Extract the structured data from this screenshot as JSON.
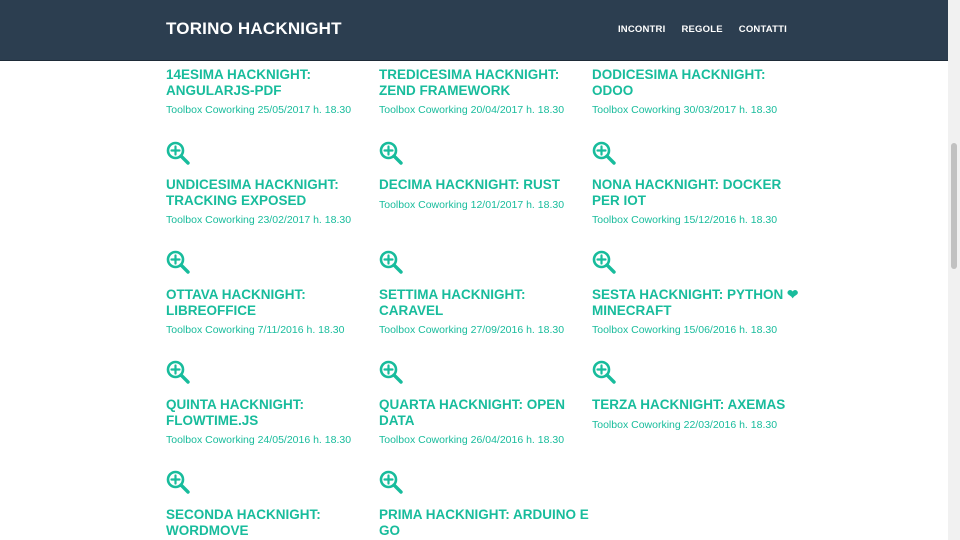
{
  "navbar": {
    "brand": "TORINO HACKNIGHT",
    "links": [
      "INCONTRI",
      "REGOLE",
      "CONTATTI"
    ]
  },
  "colors": {
    "navbar_bg": "#2c3e50",
    "accent": "#18bc9c"
  },
  "events": [
    {
      "title": "14ESIMA HACKNIGHT: ANGULARJS-PDF",
      "meta": "Toolbox Coworking 25/05/2017 h. 18.30",
      "icon": "zoom-in-icon"
    },
    {
      "title": "TREDICESIMA HACKNIGHT: ZEND FRAMEWORK",
      "meta": "Toolbox Coworking 20/04/2017 h. 18.30",
      "icon": "zoom-in-icon"
    },
    {
      "title": "DODICESIMA HACKNIGHT: ODOO",
      "meta": "Toolbox Coworking 30/03/2017 h. 18.30",
      "icon": "zoom-in-icon"
    },
    {
      "title": "UNDICESIMA HACKNIGHT: TRACKING EXPOSED",
      "meta": "Toolbox Coworking 23/02/2017 h. 18.30",
      "icon": "zoom-in-icon"
    },
    {
      "title": "DECIMA HACKNIGHT: RUST",
      "meta": "Toolbox Coworking 12/01/2017 h. 18.30",
      "icon": "zoom-in-icon"
    },
    {
      "title": "NONA HACKNIGHT: DOCKER PER IOT",
      "meta": "Toolbox Coworking 15/12/2016 h. 18.30",
      "icon": "zoom-in-icon"
    },
    {
      "title": "OTTAVA HACKNIGHT: LIBREOFFICE",
      "meta": "Toolbox Coworking 7/11/2016 h. 18.30",
      "icon": "zoom-in-icon"
    },
    {
      "title": "SETTIMA HACKNIGHT: CARAVEL",
      "meta": "Toolbox Coworking 27/09/2016 h. 18.30",
      "icon": "zoom-in-icon"
    },
    {
      "title": "SESTA HACKNIGHT: PYTHON ❤ MINECRAFT",
      "meta": "Toolbox Coworking 15/06/2016 h. 18.30",
      "icon": "zoom-in-icon"
    },
    {
      "title": "QUINTA HACKNIGHT: FLOWTIME.JS",
      "meta": "Toolbox Coworking 24/05/2016 h. 18.30",
      "icon": "zoom-in-icon"
    },
    {
      "title": "QUARTA HACKNIGHT: OPEN DATA",
      "meta": "Toolbox Coworking 26/04/2016 h. 18.30",
      "icon": "zoom-in-icon"
    },
    {
      "title": "TERZA HACKNIGHT: AXEMAS",
      "meta": "Toolbox Coworking 22/03/2016 h. 18.30",
      "icon": "zoom-in-icon"
    },
    {
      "title": "SECONDA HACKNIGHT: WORDMOVE",
      "meta": "",
      "icon": ""
    },
    {
      "title": "PRIMA HACKNIGHT: ARDUINO E GO",
      "meta": "",
      "icon": ""
    }
  ]
}
